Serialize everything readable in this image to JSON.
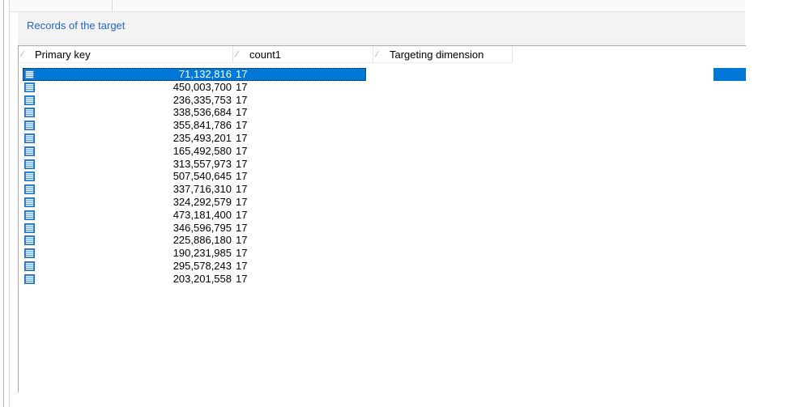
{
  "panel": {
    "title": "Records of the target"
  },
  "columns": [
    {
      "sort_glyph": "⁄",
      "label": "Primary key"
    },
    {
      "sort_glyph": "⁄",
      "label": "count1"
    },
    {
      "sort_glyph": "⁄",
      "label": "Targeting dimension"
    }
  ],
  "rows": [
    {
      "pk": "71,132,816",
      "count1": "17",
      "selected": true
    },
    {
      "pk": "450,003,700",
      "count1": "17"
    },
    {
      "pk": "236,335,753",
      "count1": "17"
    },
    {
      "pk": "338,536,684",
      "count1": "17"
    },
    {
      "pk": "355,841,786",
      "count1": "17"
    },
    {
      "pk": "235,493,201",
      "count1": "17"
    },
    {
      "pk": "165,492,580",
      "count1": "17"
    },
    {
      "pk": "313,557,973",
      "count1": "17"
    },
    {
      "pk": "507,540,645",
      "count1": "17"
    },
    {
      "pk": "337,716,310",
      "count1": "17"
    },
    {
      "pk": "324,292,579",
      "count1": "17"
    },
    {
      "pk": "473,181,400",
      "count1": "17"
    },
    {
      "pk": "346,596,795",
      "count1": "17"
    },
    {
      "pk": "225,886,180",
      "count1": "17"
    },
    {
      "pk": "190,231,985",
      "count1": "17"
    },
    {
      "pk": "295,578,243",
      "count1": "17"
    },
    {
      "pk": "203,201,558",
      "count1": "17"
    }
  ],
  "icons": {
    "row_icon": "record-list-icon"
  },
  "colors": {
    "accent": "#0078d7",
    "title": "#2166c9"
  }
}
